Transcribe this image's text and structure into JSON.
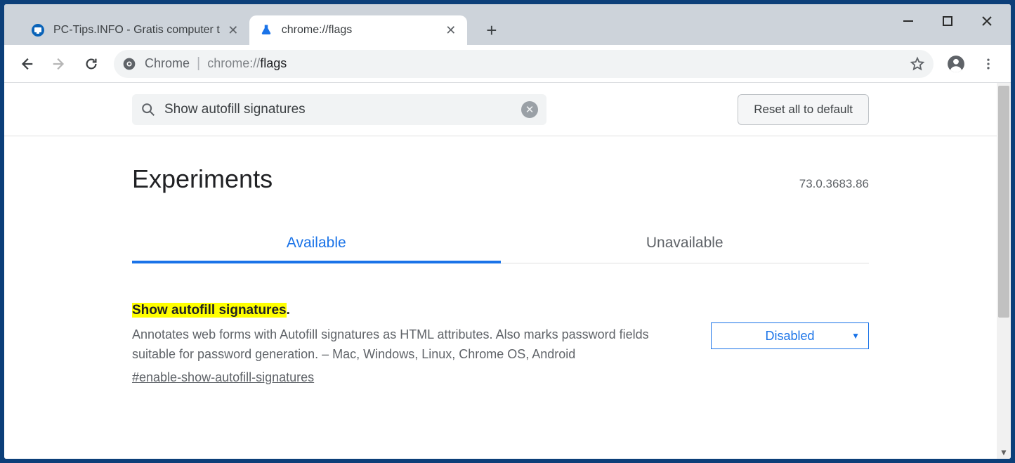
{
  "window": {
    "tabs": [
      {
        "title": "PC-Tips.INFO - Gratis computer t",
        "active": false
      },
      {
        "title": "chrome://flags",
        "active": true
      }
    ]
  },
  "toolbar": {
    "origin_label": "Chrome",
    "url_prefix": "chrome://",
    "url_path": "flags"
  },
  "flags": {
    "search_value": "Show autofill signatures",
    "reset_label": "Reset all to default",
    "heading": "Experiments",
    "version": "73.0.3683.86",
    "tab_available": "Available",
    "tab_unavailable": "Unavailable",
    "item": {
      "title_highlight": "Show autofill signatures",
      "title_suffix": ".",
      "description": "Annotates web forms with Autofill signatures as HTML attributes. Also marks password fields suitable for password generation. – Mac, Windows, Linux, Chrome OS, Android",
      "anchor": "#enable-show-autofill-signatures",
      "select_value": "Disabled"
    }
  }
}
